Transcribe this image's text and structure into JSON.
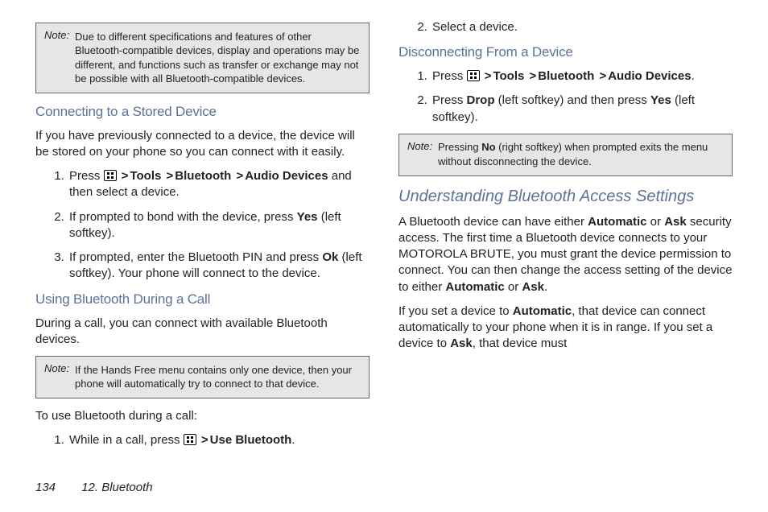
{
  "notes": {
    "n1_label": "Note:",
    "n1_body": "Due to different specifications and features of other Bluetooth-compatible devices, display and operations may be different, and functions such as transfer or exchange may not be possible with all Bluetooth-compatible devices.",
    "n2_label": "Note:",
    "n2_body": "If the Hands Free menu contains only one device, then your phone will automatically try to connect to that device.",
    "n3_label": "Note:",
    "n3_body_a": "Pressing ",
    "n3_no": "No",
    "n3_body_b": " (right softkey) when prompted exits the menu without disconnecting the device."
  },
  "headings": {
    "h_connecting": "Connecting to a Stored Device",
    "h_using": "Using Bluetooth During a Call",
    "h_disconnect": "Disconnecting From a Device",
    "h_understand": "Understanding Bluetooth Access Settings"
  },
  "paras": {
    "p_connecting": "If you have previously connected to a device, the device will be stored on your phone so you can connect with it easily.",
    "p_using": "During a call, you can connect with available Bluetooth devices.",
    "p_touse": "To use Bluetooth during a call:",
    "p_understand_a": "A Bluetooth device can have either ",
    "p_understand_b": " or ",
    "p_understand_c": " security access. The first time a Bluetooth device connects to your MOTOROLA BRUTE, you must grant the device permission to connect. You can then change the access setting of the device to either ",
    "p_understand_d": " or ",
    "p_understand_e": ".",
    "p_set_a": "If you set a device to ",
    "p_set_b": ", that device can connect automatically to your phone when it is in range. If you set a device to ",
    "p_set_c": ", that device must"
  },
  "bold": {
    "tools": "Tools",
    "bluetooth": "Bluetooth",
    "audio_devices": "Audio Devices",
    "use_bt": "Use Bluetooth",
    "yes": "Yes",
    "ok": "Ok",
    "drop": "Drop",
    "automatic": "Automatic",
    "ask": "Ask"
  },
  "lists": {
    "conn1_a": "Press ",
    "conn1_b": " and then select a device.",
    "conn2_a": "If prompted to bond with the device, press ",
    "conn2_b": " (left softkey).",
    "conn3_a": "If prompted, enter the Bluetooth PIN and press ",
    "conn3_b": " (left softkey). Your phone will connect to the device.",
    "use1_a": "While in a call, press ",
    "use1_b": ".",
    "use2": "Select a device.",
    "disc1_a": "Press ",
    "disc1_b": ".",
    "disc2_a": "Press ",
    "disc2_b": " (left softkey) and then press ",
    "disc2_c": " (left softkey)."
  },
  "gt": ">",
  "footer": {
    "page": "134",
    "section": "12. Bluetooth"
  }
}
